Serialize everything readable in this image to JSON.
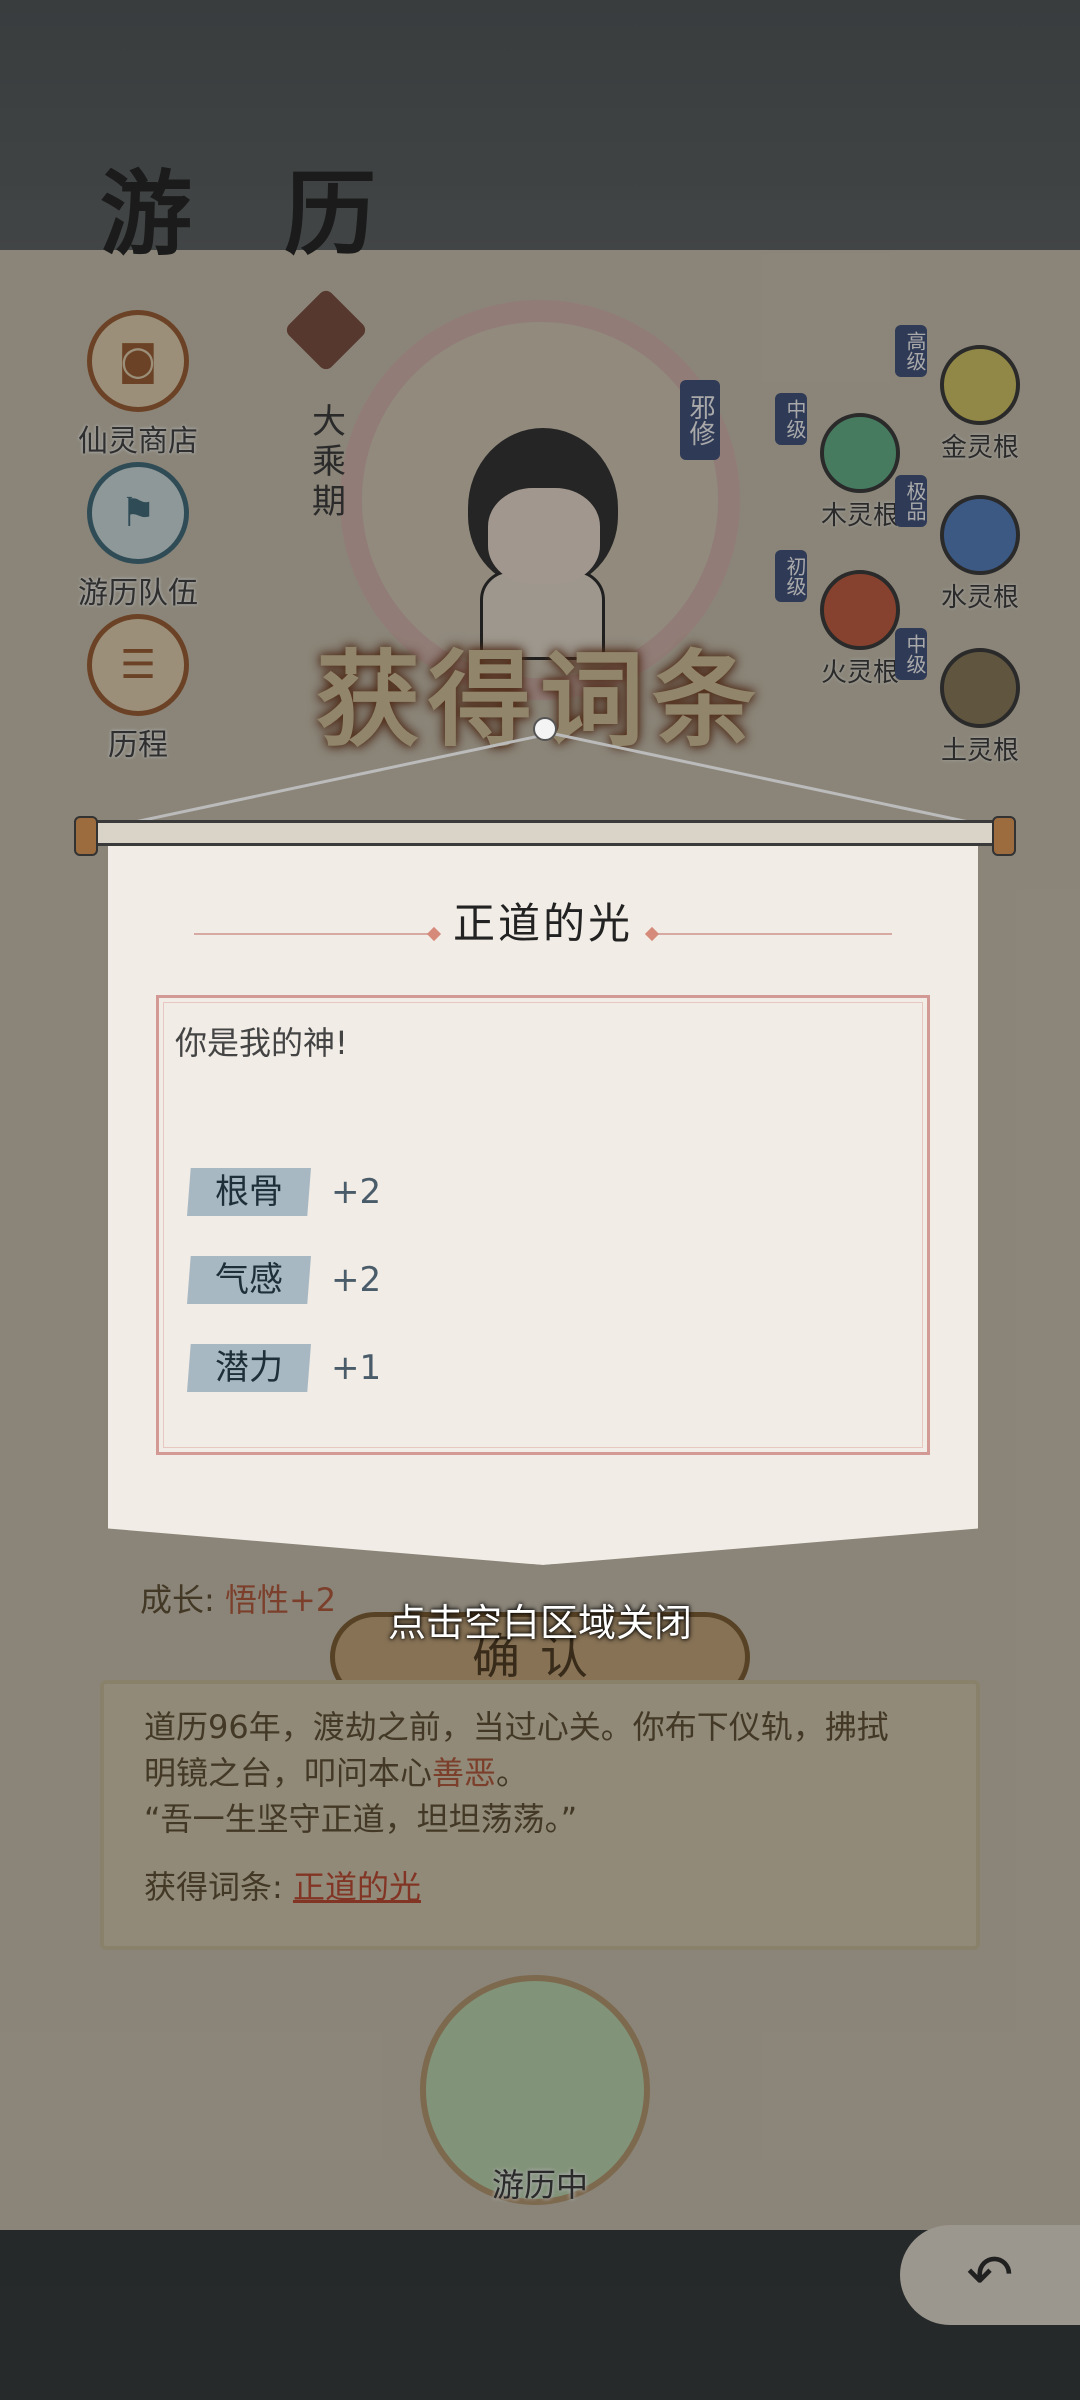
{
  "page": {
    "title": "游 历"
  },
  "side_menu": [
    {
      "label": "仙灵商店",
      "icon": "shop-icon"
    },
    {
      "label": "游历队伍",
      "icon": "team-flag-icon"
    },
    {
      "label": "历程",
      "icon": "scroll-icon"
    }
  ],
  "character": {
    "realm": "大乘期",
    "tag": "邪修"
  },
  "spirit_roots": [
    {
      "grade": "高级",
      "name": "金灵根",
      "color": "#d8c960"
    },
    {
      "grade": "中级",
      "name": "木灵根",
      "color": "#5fb58a"
    },
    {
      "grade": "极品",
      "name": "水灵根",
      "color": "#4f7fc4"
    },
    {
      "grade": "初级",
      "name": "火灵根",
      "color": "#c75a3a"
    },
    {
      "grade": "中级",
      "name": "土灵根",
      "color": "#8a7a55"
    }
  ],
  "banner": {
    "text": "获得词条"
  },
  "modal": {
    "title": "正道的光",
    "description": "你是我的神!",
    "stats": [
      {
        "name": "根骨",
        "value": "+2"
      },
      {
        "name": "气感",
        "value": "+2"
      },
      {
        "name": "潜力",
        "value": "+1"
      }
    ]
  },
  "hint": {
    "close_text": "点击空白区域关闭"
  },
  "background": {
    "growth_label": "成长:",
    "growth_value": "悟性+2",
    "confirm_label": "确认",
    "log": {
      "text_line1": "道历96年，渡劫之前，当过心关。你布下仪轨，拂拭",
      "text_line2_a": "明镜之台，叩问本心",
      "text_line2_b": "善恶",
      "text_line2_c": "。",
      "text_line3": "“吾一生坚守正道，坦坦荡荡。”",
      "entry_label": "获得词条:",
      "entry_link": "正道的光"
    },
    "travel_status": "游历中"
  }
}
